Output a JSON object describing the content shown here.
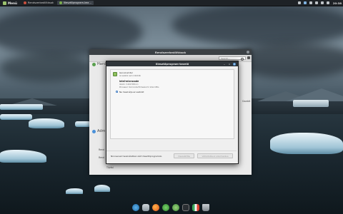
{
  "panel": {
    "menu_label": "Menü",
    "tasks": [
      {
        "label": "Rendszerbeállítások",
        "active": false
      },
      {
        "label": "Illesztőprogram-kez…",
        "active": true
      }
    ],
    "clock": "20:38"
  },
  "settings_window": {
    "title": "Rendszerbeállítások",
    "search_placeholder": "Search…",
    "section1_label": "Hard",
    "section2_label": "Adm",
    "side_label_right": "Gazdát",
    "left_label_1": "Rend",
    "left_label_2": "Rend",
    "bottom_label": "Tűzfal"
  },
  "driver_dialog": {
    "title": "Illesztőprogram-kezelő",
    "device_heading": "GenuineIntel",
    "device_sub": "Az eszköz nem működik",
    "driver_name": "intel-microcode",
    "driver_version": "Verzió: 3.20170511.1",
    "driver_desc": "Processor microcode firmware for Intel CPUs",
    "option_label": "Ne használja az eszközt",
    "status_text": "Nincsenek használatban zárt illesztőprogramok.",
    "button_revert": "Visszaállítás",
    "button_apply": "Változtatások alkalmazása"
  },
  "dock": {
    "icons": [
      "show-desktop-icon",
      "files-icon",
      "firefox-icon",
      "update-icon",
      "software-icon",
      "terminal-icon",
      "flag-icon",
      "trash-icon"
    ]
  },
  "colors": {
    "panel": "#1e2226",
    "accent": "#4a8fd0",
    "mint_green": "#9bc26d"
  }
}
